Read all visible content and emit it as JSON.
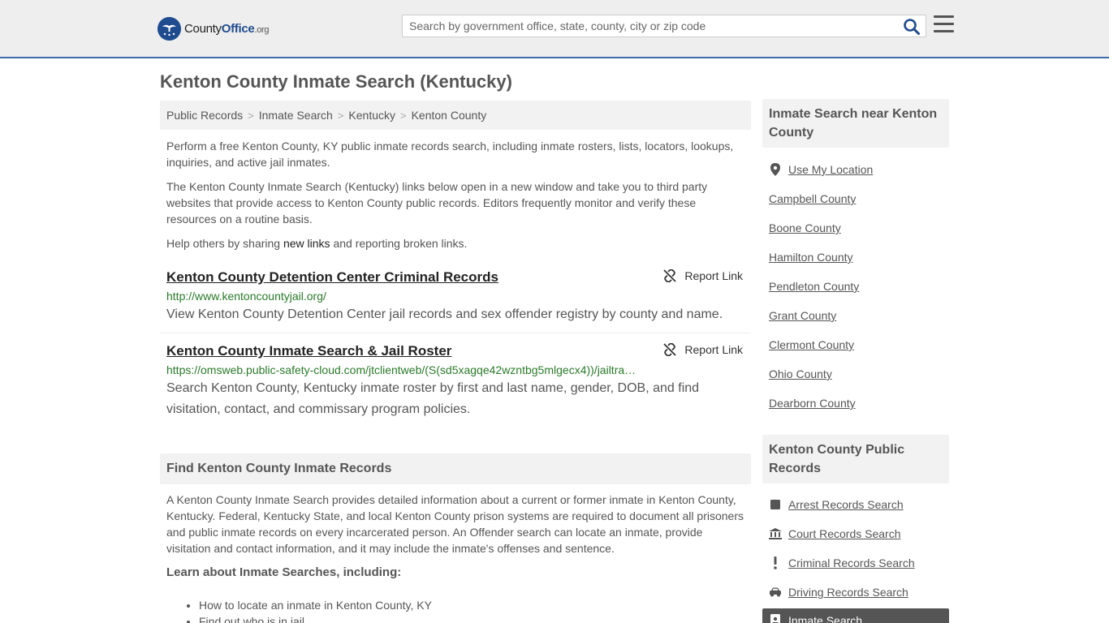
{
  "header": {
    "logo": {
      "county": "County",
      "office": "Office",
      "org": ".org"
    },
    "search": {
      "placeholder": "Search by government office, state, county, city or zip code"
    }
  },
  "page_title": "Kenton County Inmate Search (Kentucky)",
  "breadcrumb": [
    "Public Records",
    "Inmate Search",
    "Kentucky",
    "Kenton County"
  ],
  "intro": {
    "p1": "Perform a free Kenton County, KY public inmate records search, including inmate rosters, lists, locators, lookups, inquiries, and active jail inmates.",
    "p2": "The Kenton County Inmate Search (Kentucky) links below open in a new window and take you to third party websites that provide access to Kenton County public records. Editors frequently monitor and verify these resources on a routine basis.",
    "p3_before": "Help others by sharing ",
    "p3_link": "new links",
    "p3_after": " and reporting broken links."
  },
  "links": [
    {
      "title": "Kenton County Detention Center Criminal Records",
      "report": "Report Link",
      "url": "http://www.kentoncountyjail.org/",
      "desc": "View Kenton County Detention Center jail records and sex offender registry by county and name."
    },
    {
      "title": "Kenton County Inmate Search & Jail Roster",
      "report": "Report Link",
      "url": "https://omsweb.public-safety-cloud.com/jtclientweb/(S(sd5xagqe42wzntbg5mlgecx4))/jailtracker/index/KENTON_COUNTY_KY",
      "desc": "Search Kenton County, Kentucky inmate roster by first and last name, gender, DOB, and find visitation, contact, and commissary program policies."
    }
  ],
  "find_section": {
    "heading": "Find Kenton County Inmate Records",
    "body": "A Kenton County Inmate Search provides detailed information about a current or former inmate in Kenton County, Kentucky. Federal, Kentucky State, and local Kenton County prison systems are required to document all prisoners and public inmate records on every incarcerated person. An Offender search can locate an inmate, provide visitation and contact information, and it may include the inmate's offenses and sentence.",
    "learn_heading": "Learn about Inmate Searches, including:",
    "learn_items": [
      "How to locate an inmate in Kenton County, KY",
      "Find out who is in jail"
    ]
  },
  "sidebar": {
    "nearby_heading": "Inmate Search near Kenton County",
    "use_location": "Use My Location",
    "nearby": [
      "Campbell County",
      "Boone County",
      "Hamilton County",
      "Pendleton County",
      "Grant County",
      "Clermont County",
      "Ohio County",
      "Dearborn County"
    ],
    "records_heading": "Kenton County Public Records",
    "records": [
      {
        "label": "Arrest Records Search",
        "icon": "square-icon"
      },
      {
        "label": "Court Records Search",
        "icon": "courthouse-icon"
      },
      {
        "label": "Criminal Records Search",
        "icon": "exclamation-icon"
      },
      {
        "label": "Driving Records Search",
        "icon": "car-icon"
      }
    ],
    "active": {
      "label": "Inmate Search",
      "icon": "id-card-icon"
    }
  }
}
